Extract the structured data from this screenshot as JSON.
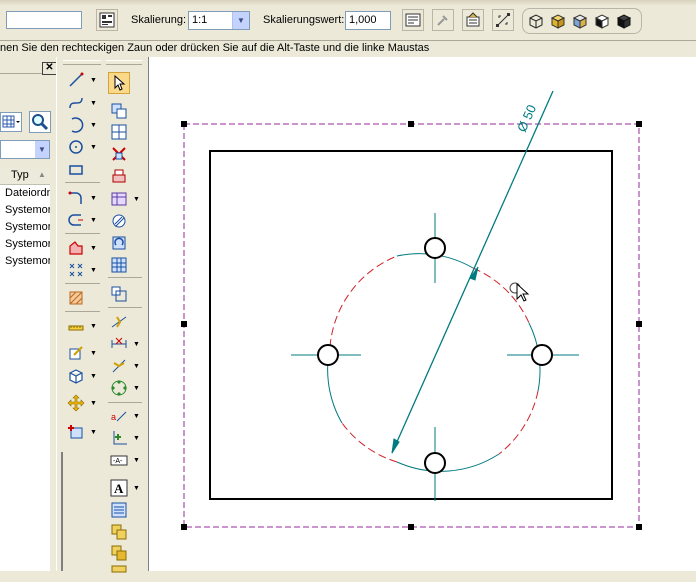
{
  "toolbar": {
    "name_value": "",
    "scale_label": "Skalierung:",
    "scale_value": "1:1",
    "scale_factor_label": "Skalierungswert:",
    "scale_factor_value": "1,000"
  },
  "status": {
    "prompt": "nen Sie den rechteckigen Zaun oder drücken Sie auf die Alt-Taste und die linke Maustas"
  },
  "left_panel": {
    "combo_value": "",
    "column_header": "Typ",
    "rows": [
      "Dateiordn",
      "Systemor",
      "Systemor",
      "Systemor",
      "Systemor"
    ]
  },
  "drawing": {
    "dimension_text": "Ø 50",
    "colors": {
      "geometry": "#000000",
      "dimension": "#007b80",
      "construction": "#d0202a",
      "fence": "#9a2a9a",
      "handle": "#000000"
    }
  },
  "icons": [
    "settings-icon",
    "scale-icon",
    "lock-icon",
    "fit-icon",
    "view-cube-icons",
    "select-arrow-icon",
    "line-icon",
    "arc-icon",
    "circle-icon",
    "rectangle-icon",
    "fillet-icon",
    "text-icon",
    "dimension-icon",
    "hatch-icon",
    "move-icon",
    "cursor-icon"
  ]
}
